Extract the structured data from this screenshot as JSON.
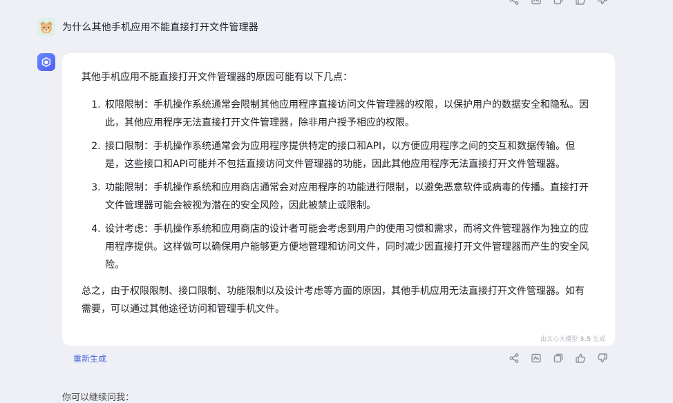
{
  "user_message": "为什么其他手机应用不能直接打开文件管理器",
  "response": {
    "intro": "其他手机应用不能直接打开文件管理器的原因可能有以下几点：",
    "points": [
      "权限限制：手机操作系统通常会限制其他应用程序直接访问文件管理器的权限，以保护用户的数据安全和隐私。因此，其他应用程序无法直接打开文件管理器，除非用户授予相应的权限。",
      "接口限制：手机操作系统通常会为应用程序提供特定的接口和API，以方便应用程序之间的交互和数据传输。但是，这些接口和API可能并不包括直接访问文件管理器的功能，因此其他应用程序无法直接打开文件管理器。",
      "功能限制：手机操作系统和应用商店通常会对应用程序的功能进行限制，以避免恶意软件或病毒的传播。直接打开文件管理器可能会被视为潜在的安全风险，因此被禁止或限制。",
      "设计考虑：手机操作系统和应用商店的设计者可能会考虑到用户的使用习惯和需求，而将文件管理器作为独立的应用程序提供。这样做可以确保用户能够更方便地管理和访问文件，同时减少因直接打开文件管理器而产生的安全风险。"
    ],
    "summary": "总之，由于权限限制、接口限制、功能限制以及设计考虑等方面的原因，其他手机应用无法直接打开文件管理器。如有需要，可以通过其他途径访问和管理手机文件。",
    "watermark_prefix": "由文心大模型",
    "watermark_version": "3.5",
    "watermark_suffix": "生成"
  },
  "regenerate_label": "重新生成",
  "continue_label": "你可以继续问我：",
  "icons": [
    "share-icon",
    "image-icon",
    "copy-icon",
    "thumbs-up-icon",
    "thumbs-down-icon"
  ],
  "colors": {
    "accent": "#4c66d9",
    "background": "#eef0f6",
    "card": "#ffffff"
  }
}
